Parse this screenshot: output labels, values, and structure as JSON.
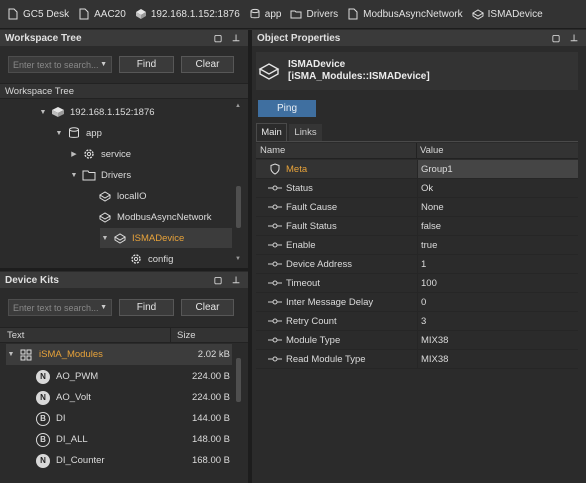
{
  "breadcrumb": [
    {
      "label": "GC5 Desk",
      "icon": "document-icon"
    },
    {
      "label": "AAC20",
      "icon": "document-icon"
    },
    {
      "label": "192.168.1.152:1876",
      "icon": "station-icon"
    },
    {
      "label": "app",
      "icon": "database-icon"
    },
    {
      "label": "Drivers",
      "icon": "folder-icon"
    },
    {
      "label": "ModbusAsyncNetwork",
      "icon": "document-icon"
    },
    {
      "label": "ISMADevice",
      "icon": "device-icon"
    }
  ],
  "workspace": {
    "title": "Workspace Tree",
    "search_placeholder": "Enter text to search...",
    "find_label": "Find",
    "clear_label": "Clear",
    "subheader": "Workspace Tree",
    "tree": [
      {
        "label": "192.168.1.152:1876",
        "icon": "station-icon",
        "arrow": "down"
      },
      {
        "label": "app",
        "icon": "database-icon",
        "arrow": "down"
      },
      {
        "label": "service",
        "icon": "gear-icon",
        "arrow": "right"
      },
      {
        "label": "Drivers",
        "icon": "folder-icon",
        "arrow": "down"
      },
      {
        "label": "localIO",
        "icon": "localio-icon",
        "arrow": ""
      },
      {
        "label": "ModbusAsyncNetwork",
        "icon": "network-icon",
        "arrow": ""
      },
      {
        "label": "ISMADevice",
        "icon": "device-icon",
        "arrow": "down",
        "selected": true
      },
      {
        "label": "config",
        "icon": "gear-icon",
        "arrow": ""
      }
    ]
  },
  "kits": {
    "title": "Device Kits",
    "search_placeholder": "Enter text to search...",
    "find_label": "Find",
    "clear_label": "Clear",
    "col_text": "Text",
    "col_size": "Size",
    "root": {
      "label": "iSMA_Modules",
      "size": "2.02 kB"
    },
    "items": [
      {
        "badge": "N",
        "label": "AO_PWM",
        "size": "224.00 B"
      },
      {
        "badge": "N",
        "label": "AO_Volt",
        "size": "224.00 B"
      },
      {
        "badge": "B",
        "label": "DI",
        "size": "144.00 B"
      },
      {
        "badge": "B",
        "label": "DI_ALL",
        "size": "148.00 B"
      },
      {
        "badge": "N",
        "label": "DI_Counter",
        "size": "168.00 B"
      }
    ]
  },
  "properties": {
    "title": "Object Properties",
    "object_name": "ISMADevice",
    "object_type": "[iSMA_Modules::ISMADevice]",
    "ping_label": "Ping",
    "tabs": [
      "Main",
      "Links"
    ],
    "col_name": "Name",
    "col_value": "Value",
    "rows": [
      {
        "name": "Meta",
        "value": "Group1"
      },
      {
        "name": "Status",
        "value": "Ok"
      },
      {
        "name": "Fault Cause",
        "value": "None"
      },
      {
        "name": "Fault Status",
        "value": "false"
      },
      {
        "name": "Enable",
        "value": "true"
      },
      {
        "name": "Device Address",
        "value": "1"
      },
      {
        "name": "Timeout",
        "value": "100"
      },
      {
        "name": "Inter Message Delay",
        "value": "0"
      },
      {
        "name": "Retry Count",
        "value": "3"
      },
      {
        "name": "Module Type",
        "value": "MIX38"
      },
      {
        "name": "Read Module Type",
        "value": "MIX38"
      }
    ]
  },
  "colors": {
    "accent": "#e8a33a",
    "ping": "#3f6fa0",
    "background": "#2b2b2b"
  }
}
